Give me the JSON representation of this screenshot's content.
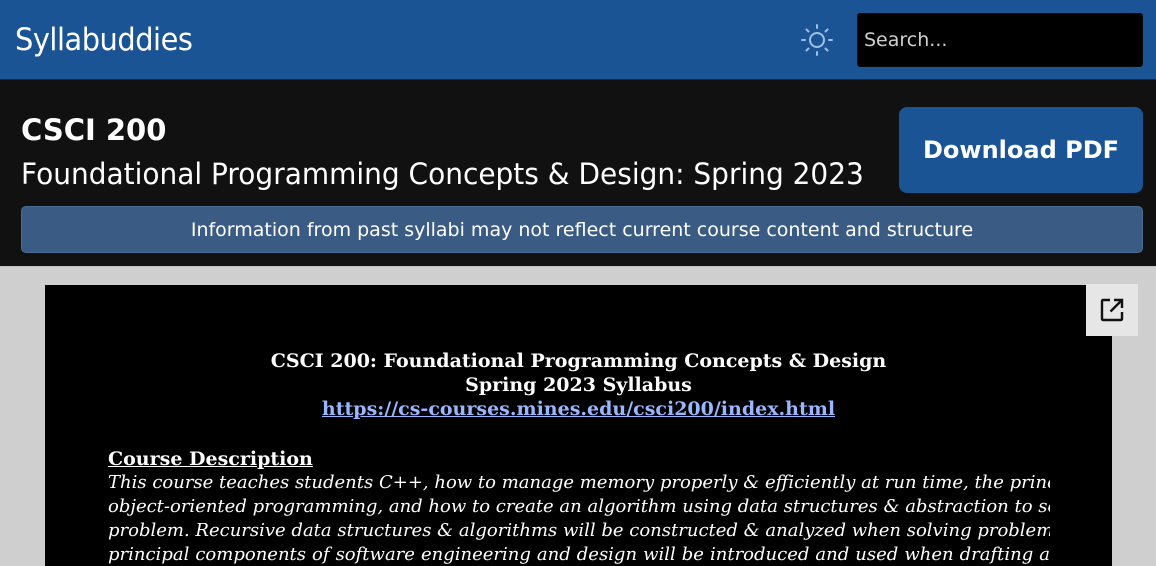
{
  "navbar": {
    "brand": "Syllabuddies",
    "theme_icon": "sun-icon",
    "search_placeholder": "Search..."
  },
  "course": {
    "code": "CSCI 200",
    "title": "Foundational Programming Concepts & Design: Spring 2023",
    "download_label": "Download PDF",
    "notice": "Information from past syllabi may not reflect current course content and structure"
  },
  "pdf": {
    "popout_icon": "open-in-new-icon",
    "heading_line1": "CSCI 200: Foundational Programming Concepts & Design",
    "heading_line2": "Spring 2023 Syllabus",
    "link": "https://cs-courses.mines.edu/csci200/index.html",
    "section_title": "Course Description",
    "description_lines": [
      "This course teaches students C++, how to manage memory properly & efficiently at run time, the principles of",
      "object-oriented programming, and how to create an algorithm using data structures & abstraction to solve a",
      "problem. Recursive data structures & algorithms will be constructed & analyzed when solving problems. Initial",
      "principal components of software engineering and design will be introduced and used when drafting a"
    ]
  },
  "colors": {
    "navbar": "#1a5494",
    "background": "#111111",
    "notice": "#3a5c84",
    "link": "#9ab6ff"
  }
}
